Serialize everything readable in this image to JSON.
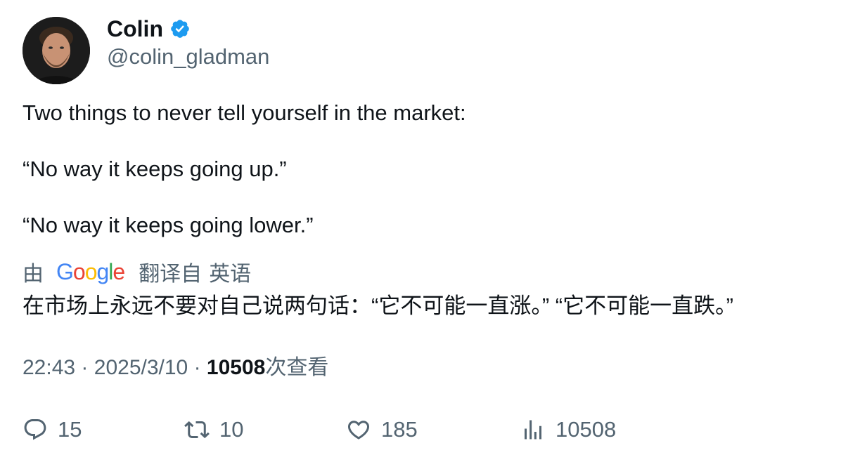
{
  "author": {
    "name": "Colin",
    "handle": "@colin_gladman",
    "verified": true,
    "verified_color": "#1d9bf0"
  },
  "tweet": {
    "paragraphs": [
      "Two things to never tell yourself in the market:",
      "“No way it keeps going up.”",
      "“No way it keeps going lower.”"
    ]
  },
  "translation": {
    "by_label": "由",
    "provider": "Google",
    "from_label": "翻译自",
    "language": "英语",
    "text": "在市场上永远不要对自己说两句话：“它不可能一直涨。” “它不可能一直跌。”"
  },
  "meta": {
    "time": "22:43",
    "separator": "·",
    "date": "2025/3/10",
    "views_count": "10508",
    "views_label": "次查看"
  },
  "actions": {
    "replies": "15",
    "retweets": "10",
    "likes": "185",
    "views": "10508"
  },
  "icons": {
    "reply": "reply-icon",
    "retweet": "retweet-icon",
    "like": "heart-icon",
    "views": "bar-chart-icon",
    "verified": "verified-badge-icon"
  }
}
